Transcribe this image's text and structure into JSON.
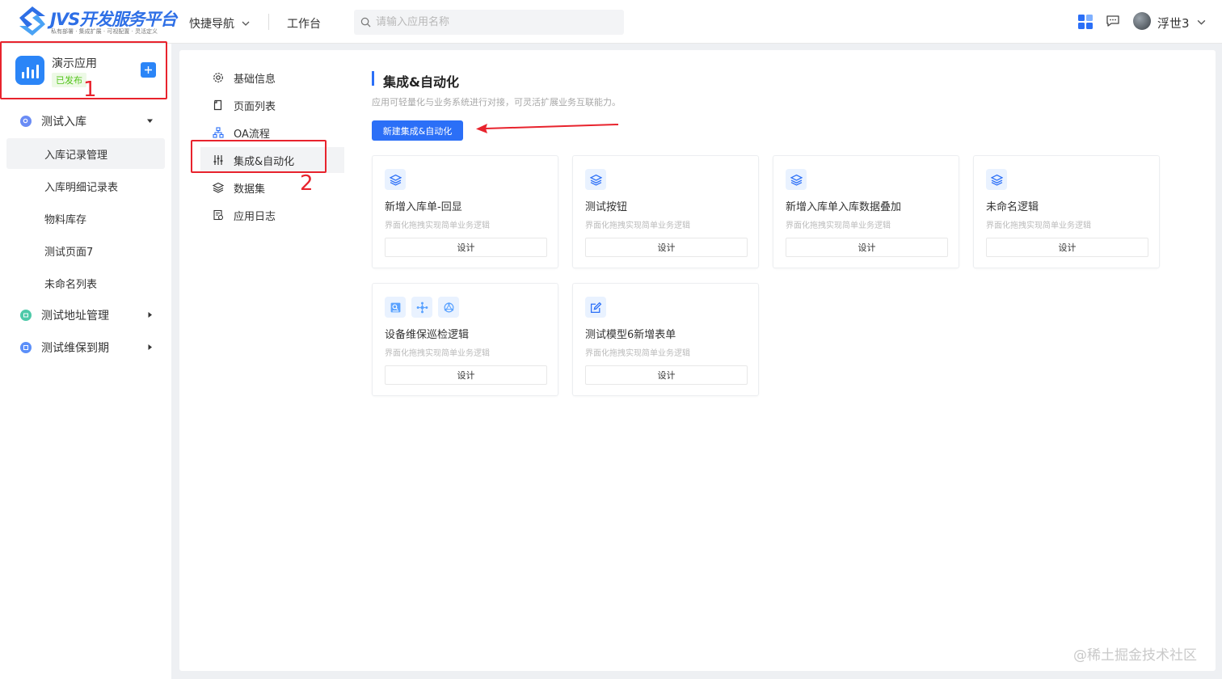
{
  "header": {
    "logo_title": "JVS开发服务平台",
    "logo_subtitle": "私有部署 · 集成扩展 · 可视配置 · 灵活定义",
    "quick_nav_label": "快捷导航",
    "workbench_label": "工作台",
    "search_placeholder": "请输入应用名称",
    "user_name": "浮世3"
  },
  "sidebar": {
    "app_name": "演示应用",
    "app_status": "已发布",
    "annotation_1": "1",
    "groups": [
      {
        "label": "测试入库",
        "expanded": true,
        "icon_color": "#6a8cf5"
      },
      {
        "label": "测试地址管理",
        "expanded": false,
        "icon_color": "#4ec9a8"
      },
      {
        "label": "测试维保到期",
        "expanded": false,
        "icon_color": "#5b8ff9"
      }
    ],
    "sub_items": [
      "入库记录管理",
      "入库明细记录表",
      "物料库存",
      "测试页面7",
      "未命名列表"
    ],
    "active_sub": "入库记录管理"
  },
  "settings_nav": {
    "items": [
      "基础信息",
      "页面列表",
      "OA流程",
      "集成&自动化",
      "数据集",
      "应用日志"
    ],
    "active": "集成&自动化",
    "annotation_2": "2"
  },
  "content": {
    "title": "集成&自动化",
    "description": "应用可轻量化与业务系统进行对接，可灵活扩展业务互联能力。",
    "new_button": "新建集成&自动化",
    "design_label": "设计",
    "cards": [
      {
        "title": "新增入库单-回显",
        "desc": "界面化拖拽实现简单业务逻辑"
      },
      {
        "title": "测试按钮",
        "desc": "界面化拖拽实现简单业务逻辑"
      },
      {
        "title": "新增入库单入库数据叠加",
        "desc": "界面化拖拽实现简单业务逻辑"
      },
      {
        "title": "未命名逻辑",
        "desc": "界面化拖拽实现简单业务逻辑"
      },
      {
        "title": "设备维保巡检逻辑",
        "desc": "界面化拖拽实现简单业务逻辑"
      },
      {
        "title": "测试模型6新增表单",
        "desc": "界面化拖拽实现简单业务逻辑"
      }
    ]
  },
  "colors": {
    "primary": "#2b6ff7",
    "annotation": "#e8232d",
    "status_green": "#52c41a"
  },
  "watermark": "@稀土掘金技术社区"
}
